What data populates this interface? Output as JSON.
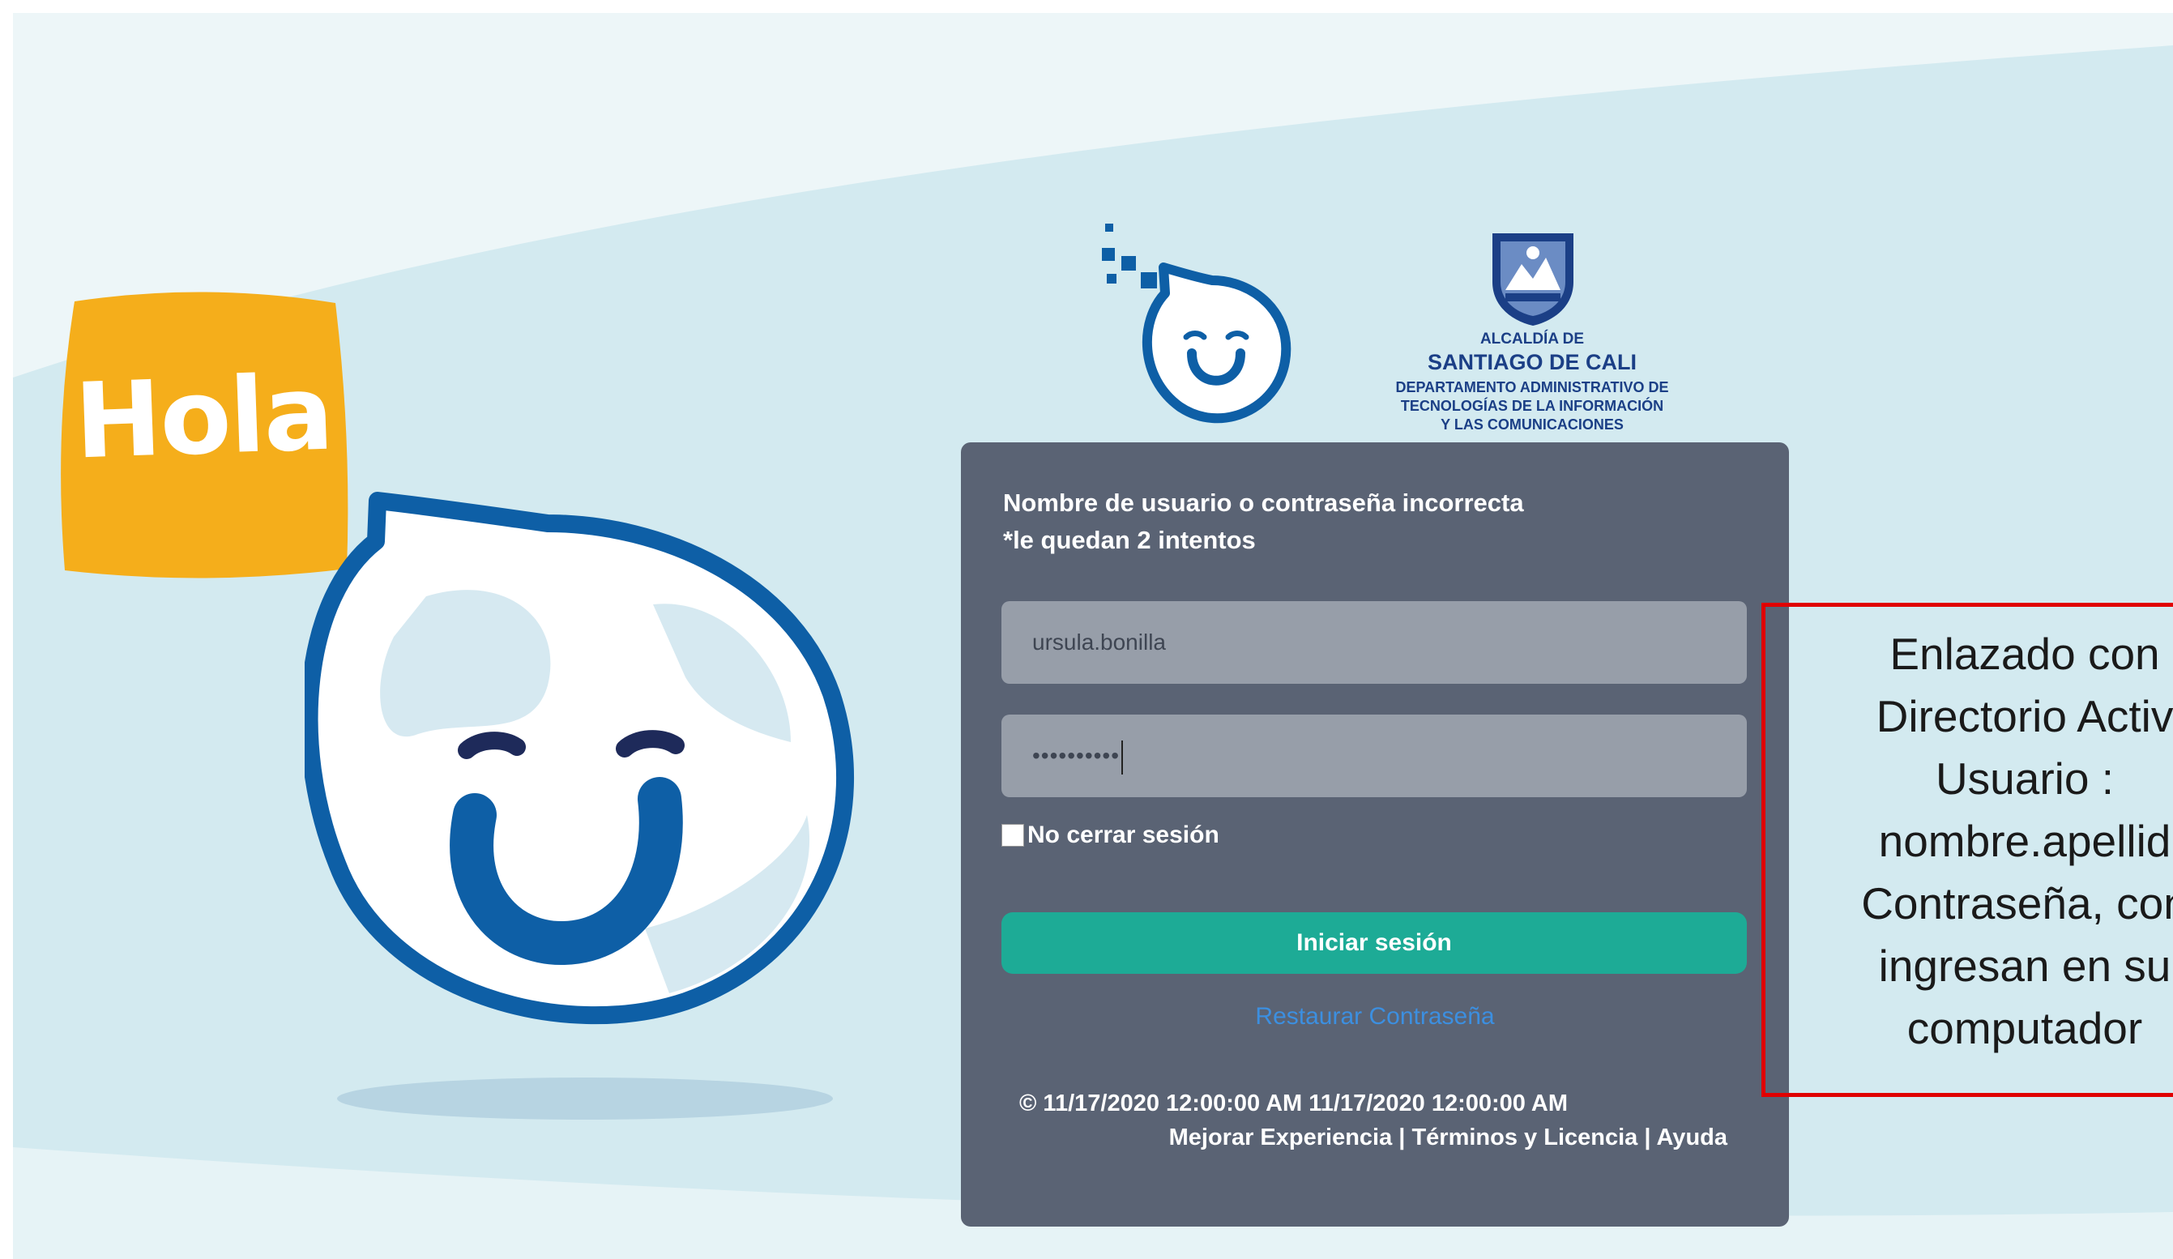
{
  "mascot": {
    "hola_text": "Hola"
  },
  "header_logos": {
    "brand_icon": "blue-drop-smiley-icon",
    "cali": {
      "line1": "ALCALDÍA DE",
      "line2": "SANTIAGO DE CALI",
      "line3": "DEPARTAMENTO ADMINISTRATIVO DE",
      "line4": "TECNOLOGÍAS DE LA INFORMACIÓN",
      "line5": "Y LAS COMUNICACIONES"
    }
  },
  "login": {
    "error_line1": "Nombre de usuario o contraseña incorrecta",
    "error_line2": "*le quedan 2 intentos",
    "username_value": "ursula.bonilla",
    "password_mask": "••••••••••",
    "remember_label": "No cerrar sesión",
    "remember_checked": false,
    "submit_label": "Iniciar sesión",
    "restore_link": "Restaurar Contraseña",
    "copyright": "© 11/17/2020 12:00:00 AM 11/17/2020 12:00:00 AM",
    "footer_links": "Mejorar Experiencia | Términos y Licencia | Ayuda"
  },
  "annotation": {
    "line1": "Enlazado con",
    "line2": "Directorio Activ",
    "line3": "Usuario :",
    "line4": "nombre.apellid",
    "line5": "Contraseña, con",
    "line6": "ingresan en su",
    "line7": "computador"
  },
  "colors": {
    "background": "#edf6f8",
    "wave": "#d3eaf0",
    "card": "#5a6374",
    "accent_teal": "#1dab96",
    "brand_blue": "#0e5fa6",
    "hola_yellow": "#f5ae1b",
    "annotation_red": "#e00000"
  }
}
